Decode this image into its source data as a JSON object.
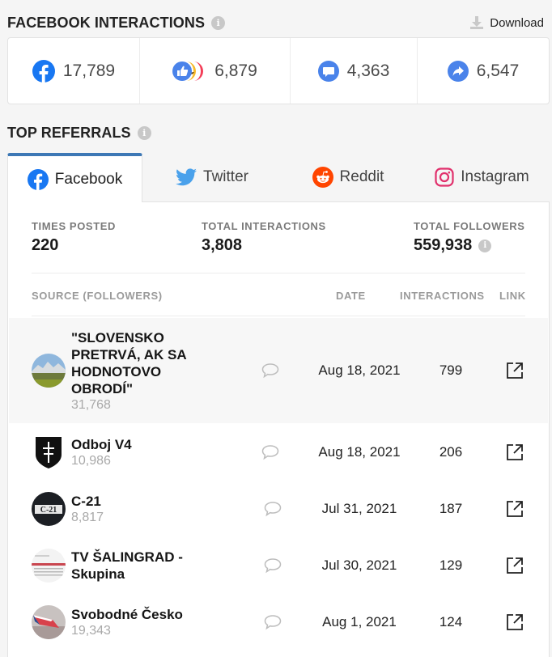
{
  "facebook_interactions": {
    "title": "FACEBOOK INTERACTIONS",
    "info_icon": "i",
    "download_label": "Download",
    "stats": [
      {
        "icon": "facebook-icon",
        "value": "17,789"
      },
      {
        "icon": "reactions-icon",
        "value": "6,879"
      },
      {
        "icon": "comment-icon",
        "value": "4,363"
      },
      {
        "icon": "share-icon",
        "value": "6,547"
      }
    ]
  },
  "top_referrals": {
    "title": "TOP REFERRALS",
    "info_icon": "i",
    "tabs": [
      {
        "label": "Facebook",
        "icon": "facebook-icon",
        "active": true
      },
      {
        "label": "Twitter",
        "icon": "twitter-icon",
        "active": false
      },
      {
        "label": "Reddit",
        "icon": "reddit-icon",
        "active": false
      },
      {
        "label": "Instagram",
        "icon": "instagram-icon",
        "active": false
      }
    ],
    "summary": {
      "times_posted_label": "TIMES POSTED",
      "times_posted": "220",
      "total_interactions_label": "TOTAL INTERACTIONS",
      "total_interactions": "3,808",
      "total_followers_label": "TOTAL FOLLOWERS",
      "total_followers": "559,938",
      "info_icon": "i"
    },
    "columns": {
      "source": "SOURCE (FOLLOWERS)",
      "date": "DATE",
      "interactions": "INTERACTIONS",
      "link": "LINK"
    },
    "rows": [
      {
        "name": "\"SLOVENSKO PRETRVÁ, AK SA HODNOTOVO OBRODÍ\"",
        "followers": "31,768",
        "date": "Aug 18, 2021",
        "interactions": "799"
      },
      {
        "name": "Odboj V4",
        "followers": "10,986",
        "date": "Aug 18, 2021",
        "interactions": "206"
      },
      {
        "name": "C-21",
        "followers": "8,817",
        "date": "Jul 31, 2021",
        "interactions": "187"
      },
      {
        "name": "TV ŠALINGRAD - Skupina",
        "followers": "",
        "date": "Jul 30, 2021",
        "interactions": "129"
      },
      {
        "name": "Svobodné Česko",
        "followers": "19,343",
        "date": "Aug 1, 2021",
        "interactions": "124"
      }
    ]
  },
  "colors": {
    "facebook_blue": "#1877f2",
    "accent_tab": "#3d78b5",
    "twitter_blue": "#1da1f2",
    "reddit_orange": "#ff4500",
    "instagram_pink": "#e1306c"
  }
}
